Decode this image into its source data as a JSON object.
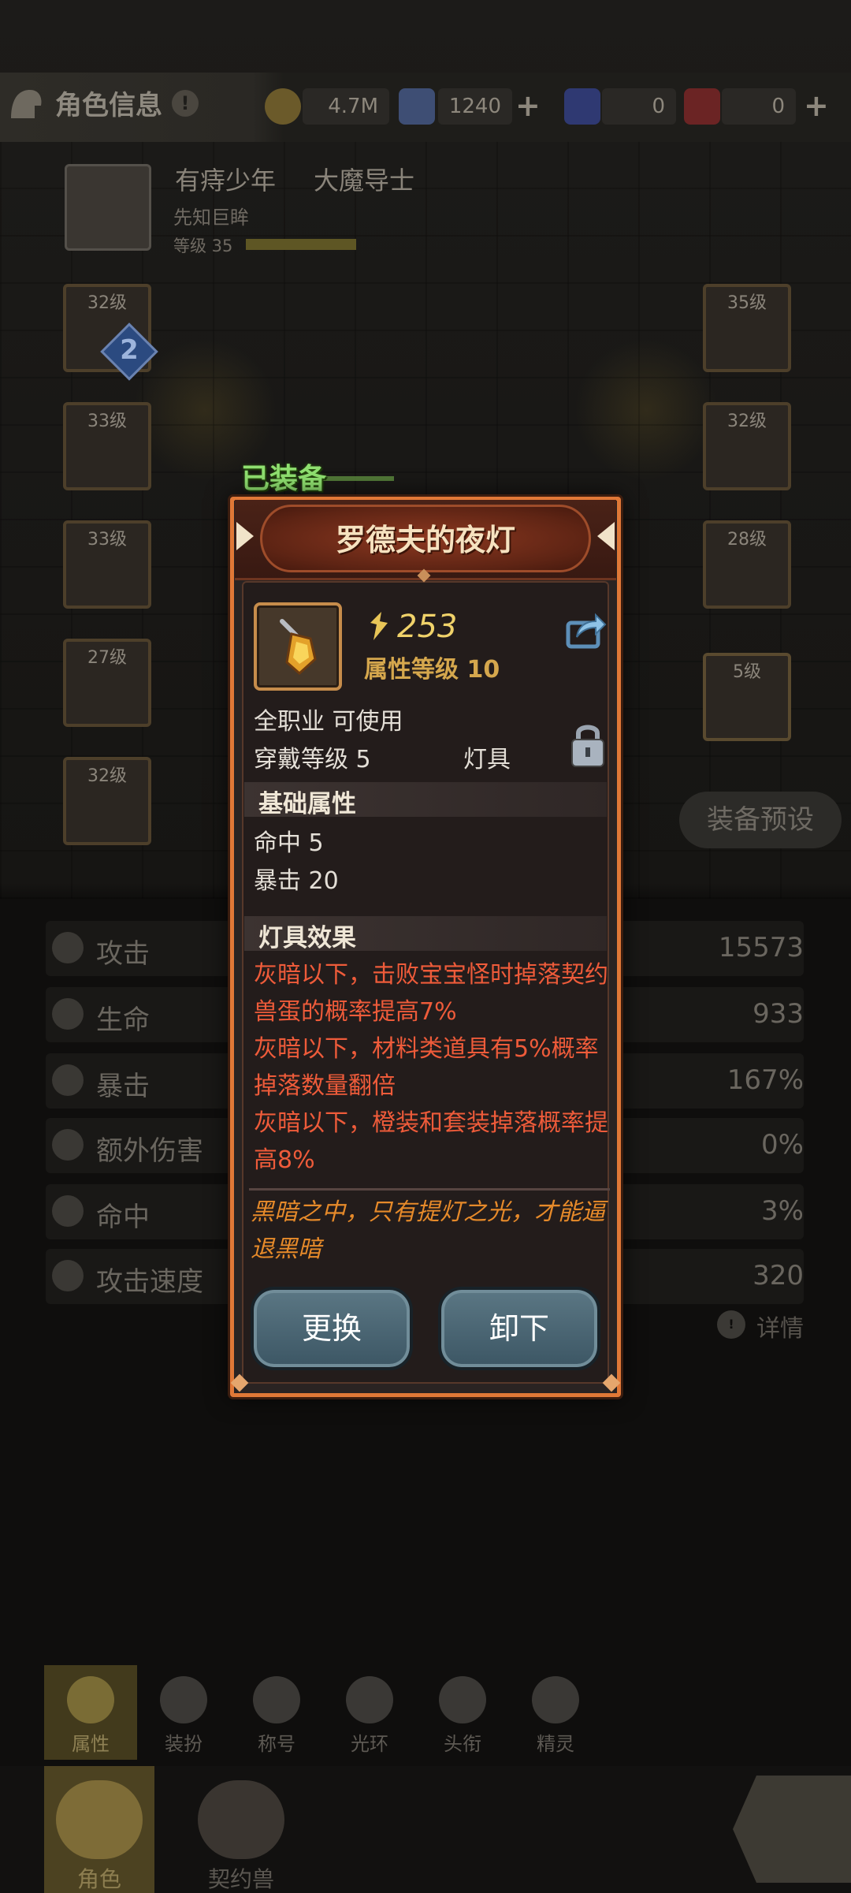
{
  "header": {
    "title": "角色信息",
    "resources": [
      {
        "name": "gold",
        "value": "4.7M"
      },
      {
        "name": "crystal",
        "value": "1240"
      },
      {
        "name": "blue-ticket",
        "value": "0"
      },
      {
        "name": "red-ticket",
        "value": "0"
      }
    ]
  },
  "character": {
    "name": "有痔少年",
    "class": "大魔导士",
    "subtitle": "先知巨眸",
    "level_text": "等级 35"
  },
  "slots": {
    "left": [
      "32级",
      "33级",
      "33级",
      "27级",
      "32级"
    ],
    "right": [
      "35级",
      "32级",
      "28级",
      "5级"
    ],
    "badge": "2"
  },
  "preset_button": "装备预设",
  "stats": [
    {
      "label": "攻击",
      "value": "15573"
    },
    {
      "label": "生命",
      "value": "933"
    },
    {
      "label": "暴击",
      "value": "167%"
    },
    {
      "label": "额外伤害",
      "value": "0%"
    },
    {
      "label": "命中",
      "value": "3%"
    },
    {
      "label": "攻击速度",
      "value": "320"
    }
  ],
  "details_link": "详情",
  "tabs": [
    "属性",
    "装扮",
    "称号",
    "光环",
    "头衔",
    "精灵"
  ],
  "bottom_nav": [
    "角色",
    "契约兽"
  ],
  "dialog": {
    "equipped_tag": "已装备",
    "item_name": "罗德夫的夜灯",
    "power": "253",
    "attr_level": "属性等级 10",
    "usable_by": "全职业 可使用",
    "wear_level": "穿戴等级 5",
    "item_type": "灯具",
    "base_attr_title": "基础属性",
    "base_attrs": [
      "命中  5",
      "暴击  20"
    ],
    "effect_title": "灯具效果",
    "effects": [
      "灰暗以下，击败宝宝怪时掉落契约兽蛋的概率提高7%",
      "灰暗以下，材料类道具有5%概率掉落数量翻倍",
      "灰暗以下，橙装和套装掉落概率提高8%"
    ],
    "flavor": "黑暗之中，只有提灯之光，才能逼退黑暗",
    "buttons": {
      "replace": "更换",
      "unequip": "卸下"
    }
  },
  "colors": {
    "dialog_border": "#e07837",
    "effect_text": "#ee5b3a",
    "flavor_text": "#e68a2a",
    "equipped_tag": "#8fe070"
  }
}
